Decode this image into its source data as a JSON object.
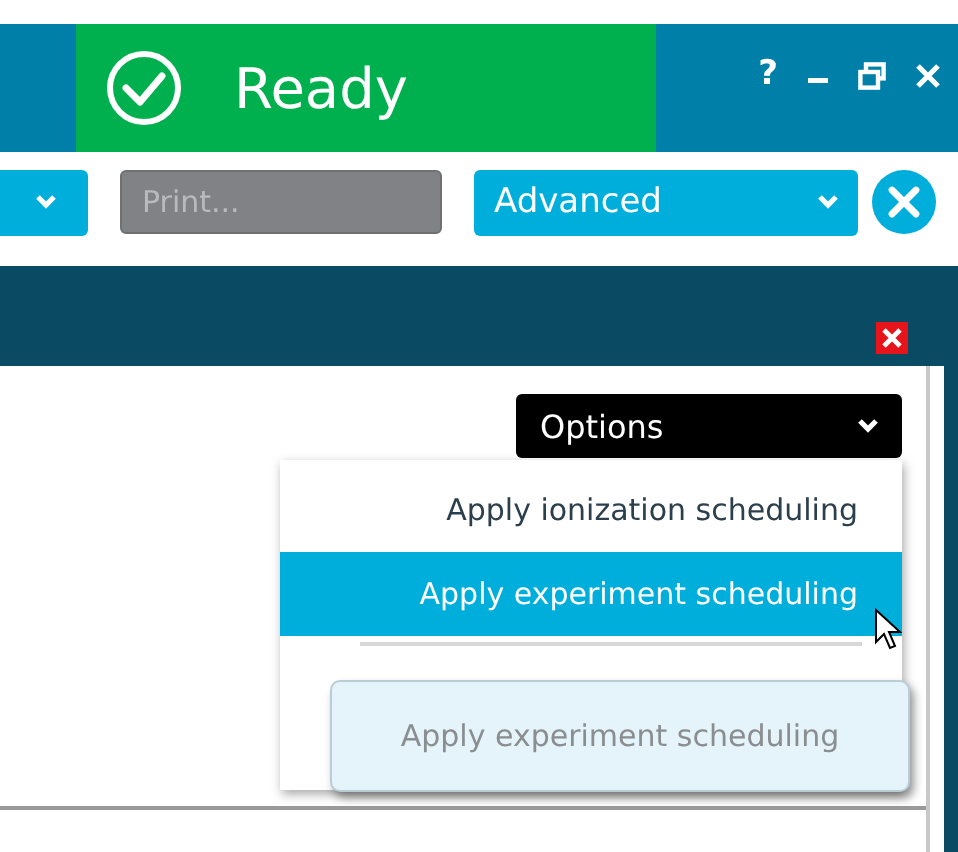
{
  "status": {
    "text": "Ready"
  },
  "window_controls": [
    {
      "kind": "help",
      "label": "?"
    },
    {
      "kind": "minimize"
    },
    {
      "kind": "restore"
    },
    {
      "kind": "close"
    }
  ],
  "toolbar": {
    "print_field": {
      "placeholder": "Print..."
    },
    "mode_dropdown": {
      "value": "Advanced"
    }
  },
  "options_button": {
    "label": "Options"
  },
  "menu": {
    "items": [
      {
        "label": "Apply ionization scheduling",
        "selected": false
      },
      {
        "label": "Apply experiment scheduling",
        "selected": true
      }
    ]
  },
  "tooltip": {
    "text": "Apply experiment scheduling"
  }
}
